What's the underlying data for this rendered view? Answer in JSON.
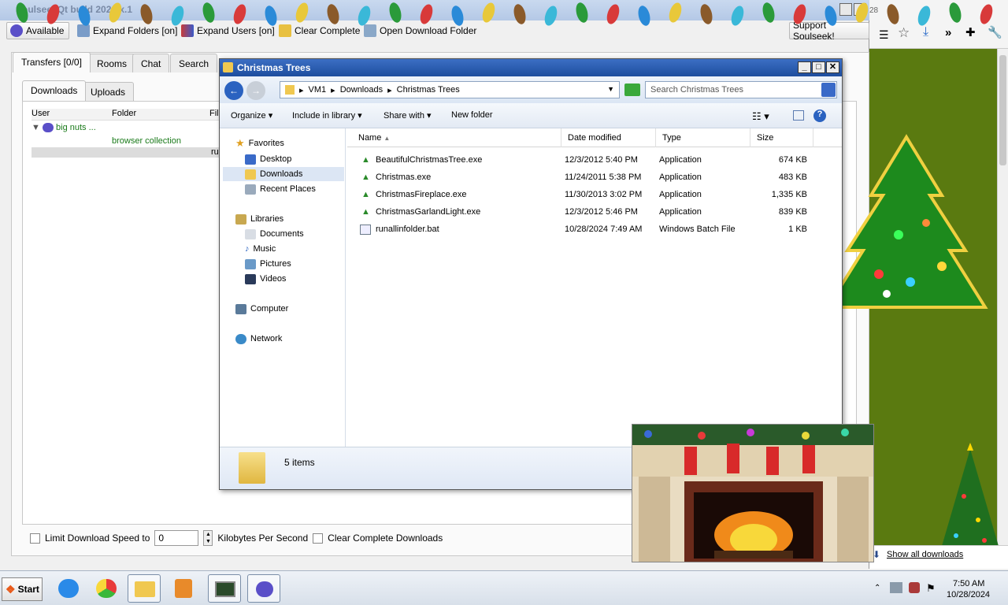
{
  "soulseek": {
    "title": "SoulseekQt build 2024.x.1",
    "toolbar": {
      "status_label": "Available",
      "expand_folders": "Expand Folders [on]",
      "expand_users": "Expand Users [on]",
      "clear_complete": "Clear Complete",
      "open_download_folder": "Open Download Folder",
      "support": "Support Soulseek!"
    },
    "tabs": [
      "Transfers [0/0]",
      "Rooms",
      "Chat",
      "Search"
    ],
    "subtabs": [
      "Downloads",
      "Uploads"
    ],
    "columns": [
      "User",
      "Folder",
      "Fil"
    ],
    "rows": {
      "user": "big nuts ...",
      "folder": "browser collection",
      "row3": "ru"
    },
    "bottom": {
      "limit_label": "Limit Download Speed to",
      "speed_value": "0",
      "unit_label": "Kilobytes Per Second",
      "clear_label": "Clear Complete Downloads"
    }
  },
  "explorer": {
    "title": "Christmas Trees",
    "breadcrumb": [
      "VM1",
      "Downloads",
      "Christmas Trees"
    ],
    "search_placeholder": "Search Christmas Trees",
    "commands": [
      "Organize",
      "Include in library",
      "Share with",
      "New folder"
    ],
    "nav": {
      "favorites": "Favorites",
      "desktop": "Desktop",
      "downloads": "Downloads",
      "recent": "Recent Places",
      "libraries": "Libraries",
      "documents": "Documents",
      "music": "Music",
      "pictures": "Pictures",
      "videos": "Videos",
      "computer": "Computer",
      "network": "Network"
    },
    "columns": {
      "name": "Name",
      "date": "Date modified",
      "type": "Type",
      "size": "Size"
    },
    "files": [
      {
        "name": "BeautifulChristmasTree.exe",
        "date": "12/3/2012 5:40 PM",
        "type": "Application",
        "size": "674 KB"
      },
      {
        "name": "Christmas.exe",
        "date": "11/24/2011 5:38 PM",
        "type": "Application",
        "size": "483 KB"
      },
      {
        "name": "ChristmasFireplace.exe",
        "date": "11/30/2013 3:02 PM",
        "type": "Application",
        "size": "1,335 KB"
      },
      {
        "name": "ChristmasGarlandLight.exe",
        "date": "12/3/2012 5:46 PM",
        "type": "Application",
        "size": "839 KB"
      },
      {
        "name": "runallinfolder.bat",
        "date": "10/28/2024 7:49 AM",
        "type": "Windows Batch File",
        "size": "1 KB"
      }
    ],
    "item_count": "5 items"
  },
  "browser": {
    "show_all": "Show all downloads",
    "tab_fragment": "28"
  },
  "taskbar": {
    "start": "Start",
    "time": "7:50 AM",
    "date": "10/28/2024"
  },
  "colors": {
    "explorer_title": "#1d4d9e",
    "soulseek_green": "#1a7a1a",
    "browser_bg": "#5a7a10"
  }
}
